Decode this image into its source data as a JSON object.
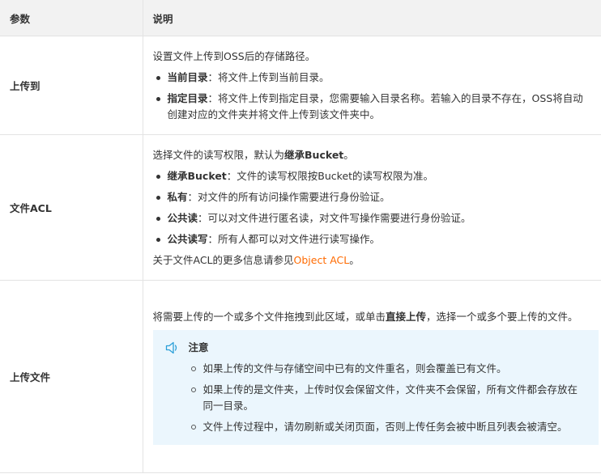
{
  "table": {
    "headers": [
      "参数",
      "说明"
    ],
    "rows": [
      {
        "name": "上传到",
        "intro": "设置文件上传到OSS后的存储路径。",
        "bullets": [
          {
            "term": "当前目录",
            "sep": "：",
            "text": "将文件上传到当前目录。"
          },
          {
            "term": "指定目录",
            "sep": "：",
            "text": "将文件上传到指定目录，您需要输入目录名称。若输入的目录不存在，OSS将自动创建对应的文件夹并将文件上传到该文件夹中。"
          }
        ]
      },
      {
        "name": "文件ACL",
        "intro_pre": "选择文件的读写权限，默认为",
        "intro_bold": "继承Bucket",
        "intro_post": "。",
        "bullets": [
          {
            "term": "继承Bucket",
            "sep": "：",
            "text": "文件的读写权限按Bucket的读写权限为准。"
          },
          {
            "term": "私有",
            "sep": "：",
            "text": "对文件的所有访问操作需要进行身份验证。"
          },
          {
            "term": "公共读",
            "sep": "：",
            "text": "可以对文件进行匿名读，对文件写操作需要进行身份验证。"
          },
          {
            "term": "公共读写",
            "sep": "：",
            "text": "所有人都可以对文件进行读写操作。"
          }
        ],
        "outro_pre": "关于文件ACL的更多信息请参见",
        "outro_link": "Object ACL",
        "outro_post": "。"
      },
      {
        "name": "上传文件",
        "intro_pre": "将需要上传的一个或多个文件拖拽到此区域，或单击",
        "intro_bold": "直接上传",
        "intro_post": "，选择一个或多个要上传的文件。",
        "notice": {
          "title": "注意",
          "icon": "speaker-icon",
          "items": [
            "如果上传的文件与存储空间中已有的文件重名，则会覆盖已有文件。",
            "如果上传的是文件夹，上传时仅会保留文件，文件夹不会保留，所有文件都会存放在同一目录。",
            "文件上传过程中，请勿刷新或关闭页面，否则上传任务会被中断且列表会被清空。"
          ]
        }
      }
    ]
  },
  "colors": {
    "header_bg": "#f2f2f2",
    "border": "#e3e3e3",
    "link": "#ff6a00",
    "notice_bg": "#ebf6fd",
    "notice_icon": "#2a9fd8"
  }
}
